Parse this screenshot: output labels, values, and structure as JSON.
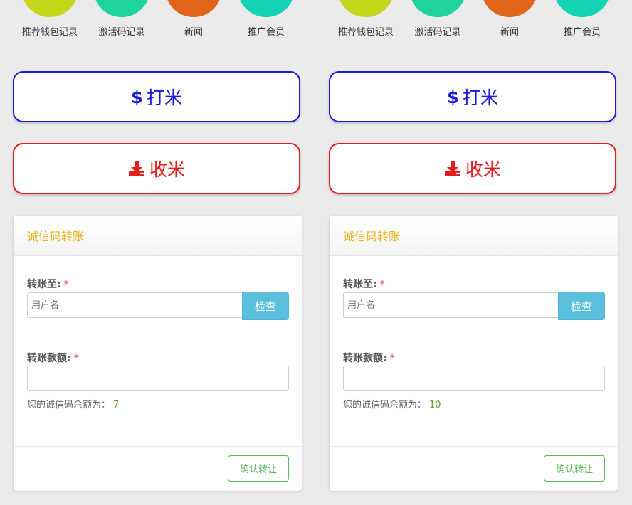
{
  "panels": [
    {
      "icons": [
        {
          "label": "推荐钱包记录",
          "color": "#c6d61a",
          "icon": "wallet-record-icon"
        },
        {
          "label": "激活码记录",
          "color": "#1fd39c",
          "icon": "activation-code-icon"
        },
        {
          "label": "新闻",
          "color": "#e0641a",
          "icon": "news-icon"
        },
        {
          "label": "推广会员",
          "color": "#14d3b4",
          "icon": "promote-member-icon"
        }
      ],
      "send_button": {
        "label": "打米",
        "icon": "dollar-icon",
        "color": "#1a1ad8"
      },
      "receive_button": {
        "label": "收米",
        "icon": "download-tray-icon",
        "color": "#e41c1c"
      },
      "transfer_card": {
        "title": "诚信码转账",
        "to_label": "转账至:",
        "to_required": "*",
        "to_placeholder": "用户名",
        "check_label": "检查",
        "amount_label": "转账款额:",
        "amount_required": "*",
        "amount_value": "",
        "balance_text": "您的诚信码余额为：",
        "balance_value": "7",
        "confirm_label": "确认转让"
      }
    },
    {
      "icons": [
        {
          "label": "推荐钱包记录",
          "color": "#c6d61a",
          "icon": "wallet-record-icon"
        },
        {
          "label": "激活码记录",
          "color": "#1fd39c",
          "icon": "activation-code-icon"
        },
        {
          "label": "新闻",
          "color": "#e0641a",
          "icon": "news-icon"
        },
        {
          "label": "推广会员",
          "color": "#14d3b4",
          "icon": "promote-member-icon"
        }
      ],
      "send_button": {
        "label": "打米",
        "icon": "dollar-icon",
        "color": "#1a1ad8"
      },
      "receive_button": {
        "label": "收米",
        "icon": "download-tray-icon",
        "color": "#e41c1c"
      },
      "transfer_card": {
        "title": "诚信码转账",
        "to_label": "转账至:",
        "to_required": "*",
        "to_placeholder": "用户名",
        "check_label": "检查",
        "amount_label": "转账款额:",
        "amount_required": "*",
        "amount_value": "",
        "balance_text": "您的诚信码余额为：",
        "balance_value": "10",
        "confirm_label": "确认转让"
      }
    }
  ]
}
